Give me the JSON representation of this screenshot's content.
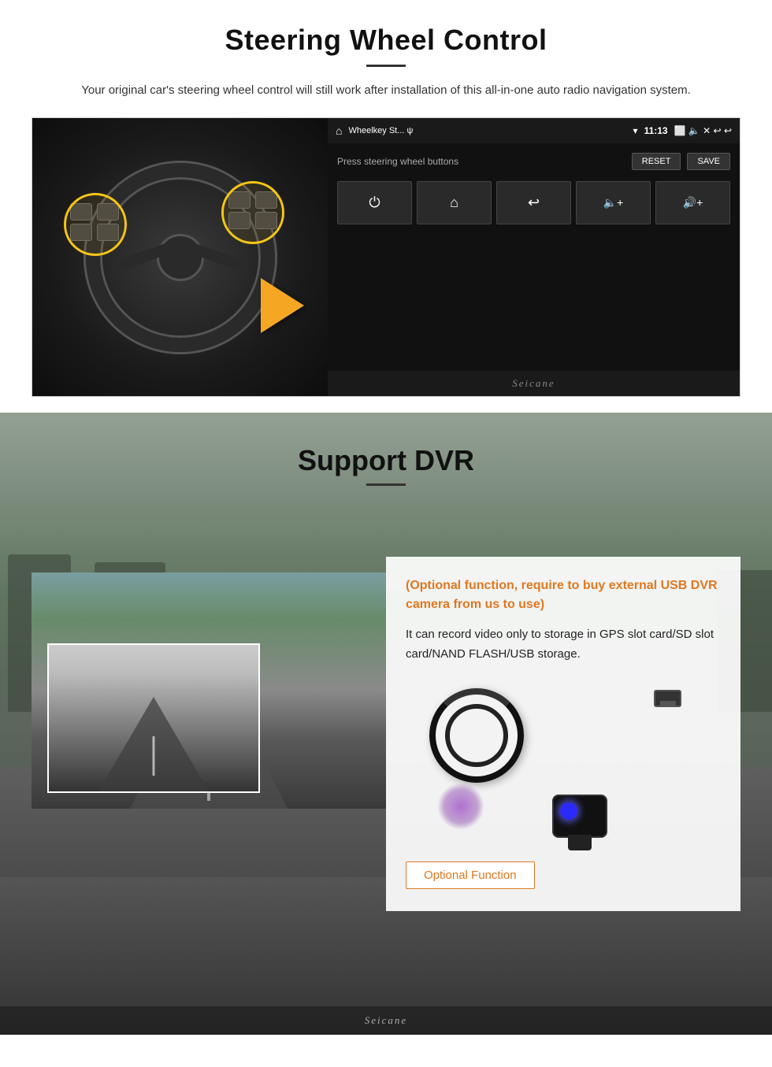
{
  "steering": {
    "title": "Steering Wheel Control",
    "subtitle": "Your original car's steering wheel control will still work after installation of this all-in-one auto radio navigation system.",
    "android": {
      "app_name": "Wheelkey St... ψ",
      "time": "11:13",
      "instruction": "Press steering wheel buttons",
      "reset_label": "RESET",
      "save_label": "SAVE",
      "buttons": [
        {
          "icon": "⏻"
        },
        {
          "icon": "⌂"
        },
        {
          "icon": "↩"
        },
        {
          "icon": "◀◀+"
        },
        {
          "icon": "▶▶+"
        }
      ]
    },
    "watermark": "Seicane"
  },
  "dvr": {
    "title": "Support DVR",
    "optional_text": "(Optional function, require to buy external USB DVR camera from us to use)",
    "description": "It can record video only to storage in GPS slot card/SD slot card/NAND FLASH/USB storage.",
    "optional_btn": "Optional Function",
    "watermark": "Seicane"
  }
}
